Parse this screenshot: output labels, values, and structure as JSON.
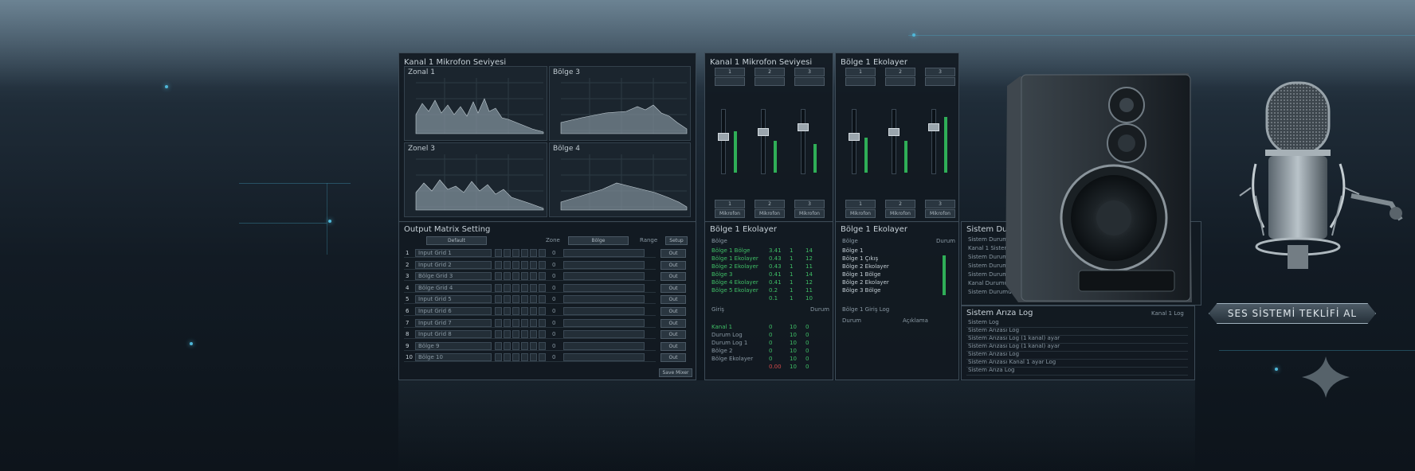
{
  "panels": {
    "analyzer": {
      "title": "Kanal 1 Mikrofon Seviyesi",
      "charts": [
        {
          "label": "Zonal 1"
        },
        {
          "label": "Bölge 3"
        },
        {
          "label": "Zonel 3"
        },
        {
          "label": "Bölge 4"
        }
      ]
    },
    "output": {
      "title": "Output Matrix Setting",
      "head_default": "Default",
      "head_zone": "Zone",
      "head_bolge": "Bölge",
      "head_range": "Range",
      "head_setup": "Setup",
      "rows": [
        {
          "n": "1",
          "name": "Input Grid 1",
          "val": "0",
          "lvl": "Out"
        },
        {
          "n": "2",
          "name": "Input Grid 2",
          "val": "0",
          "lvl": "Out"
        },
        {
          "n": "3",
          "name": "Bölge Grid 3",
          "val": "0",
          "lvl": "Out"
        },
        {
          "n": "4",
          "name": "Bölge Grid 4",
          "val": "0",
          "lvl": "Out"
        },
        {
          "n": "5",
          "name": "Input Grid 5",
          "val": "0",
          "lvl": "Out"
        },
        {
          "n": "6",
          "name": "Input Grid 6",
          "val": "0",
          "lvl": "Out"
        },
        {
          "n": "7",
          "name": "Input Grid 7",
          "val": "0",
          "lvl": "Out"
        },
        {
          "n": "8",
          "name": "Input Grid 8",
          "val": "0",
          "lvl": "Out"
        },
        {
          "n": "9",
          "name": "Bölge 9",
          "val": "0",
          "lvl": "Out"
        },
        {
          "n": "10",
          "name": "Bölge 10",
          "val": "0",
          "lvl": "Out"
        }
      ],
      "footer_button": "Save Mixer"
    },
    "mixer1": {
      "title": "Kanal 1 Mikrofon Seviyesi",
      "channels": [
        {
          "num": "1",
          "label": "Mikrofon"
        },
        {
          "num": "2",
          "label": "Mikrofon"
        },
        {
          "num": "3",
          "label": "Mikrofon"
        }
      ]
    },
    "mixer2": {
      "title": "Bölge 1 Ekolayer",
      "channels": [
        {
          "num": "1",
          "label": "Mikrofon"
        },
        {
          "num": "2",
          "label": "Mikrofon"
        },
        {
          "num": "3",
          "label": "Mikrofon"
        }
      ]
    },
    "eq1": {
      "title": "Bölge 1 Ekolayer",
      "col": "Bölge",
      "rows": [
        {
          "name": "Bölge 1 Bölge",
          "a": "3.41",
          "b": "1",
          "c": "14"
        },
        {
          "name": "Bölge 1 Ekolayer",
          "a": "0.43",
          "b": "1",
          "c": "12"
        },
        {
          "name": "Bölge 2 Ekolayer",
          "a": "0.43",
          "b": "1",
          "c": "11"
        },
        {
          "name": "Bölge 3",
          "a": "0.41",
          "b": "1",
          "c": "14"
        },
        {
          "name": "Bölge 4 Ekolayer",
          "a": "0.41",
          "b": "1",
          "c": "12"
        },
        {
          "name": "Bölge 5 Ekolayer",
          "a": "0.2",
          "b": "1",
          "c": "11"
        },
        {
          "name": "",
          "a": "0.1",
          "b": "1",
          "c": "10"
        }
      ],
      "sub_title": "Giriş",
      "sub_right": "Durum",
      "sub_rows": [
        {
          "name": "Kanal 1",
          "a": "0",
          "b": "10",
          "c": "0"
        },
        {
          "name": "Durum Log",
          "a": "0",
          "b": "10",
          "c": "0"
        },
        {
          "name": "Durum Log 1",
          "a": "0",
          "b": "10",
          "c": "0"
        },
        {
          "name": "Bölge 2",
          "a": "0",
          "b": "10",
          "c": "0"
        },
        {
          "name": "Bölge Ekolayer",
          "a": "0",
          "b": "10",
          "c": "0"
        },
        {
          "name": "",
          "a": "0.00",
          "b": "10",
          "c": "0"
        }
      ]
    },
    "eq2": {
      "title": "Bölge 1 Ekolayer",
      "col": "Bölge",
      "col_right": "Durum",
      "rows": [
        "Bölge 1",
        "Bölge 1 Çıkış",
        "Bölge 2 Ekolayer",
        "Bölge 1 Bölge",
        "Bölge 2 Ekolayer",
        "Bölge 3 Bölge"
      ],
      "sub_title": "Bölge 1 Giriş Log",
      "sub_left": "Durum",
      "sub_mid": "Açıklama"
    },
    "status": {
      "title": "Sistem Durumu",
      "rows": [
        "Sistem Durumu",
        "Kanal 1 Sistem",
        "Sistem Durumu",
        "Sistem Durumu",
        "Sistem Durumu",
        "Kanal Durumu",
        "Sistem Durumu"
      ]
    },
    "log": {
      "title": "Sistem Arıza Log",
      "right": "Kanal 1 Log",
      "rows": [
        "Sistem Log",
        "Sistem Arızası Log",
        "Sistem Arızası Log (1 kanal) ayar",
        "Sistem Arızası Log (1 kanal) ayar",
        "Sistem Arızası Log",
        "Sistem Arızası Kanal 1 ayar Log",
        "Sistem Arıza Log"
      ]
    }
  },
  "cta_label": "SES SİSTEMİ TEKLİFİ AL",
  "colors": {
    "accent": "#4fb7d8",
    "meter": "#2fae57",
    "alert": "#d04a4a"
  }
}
